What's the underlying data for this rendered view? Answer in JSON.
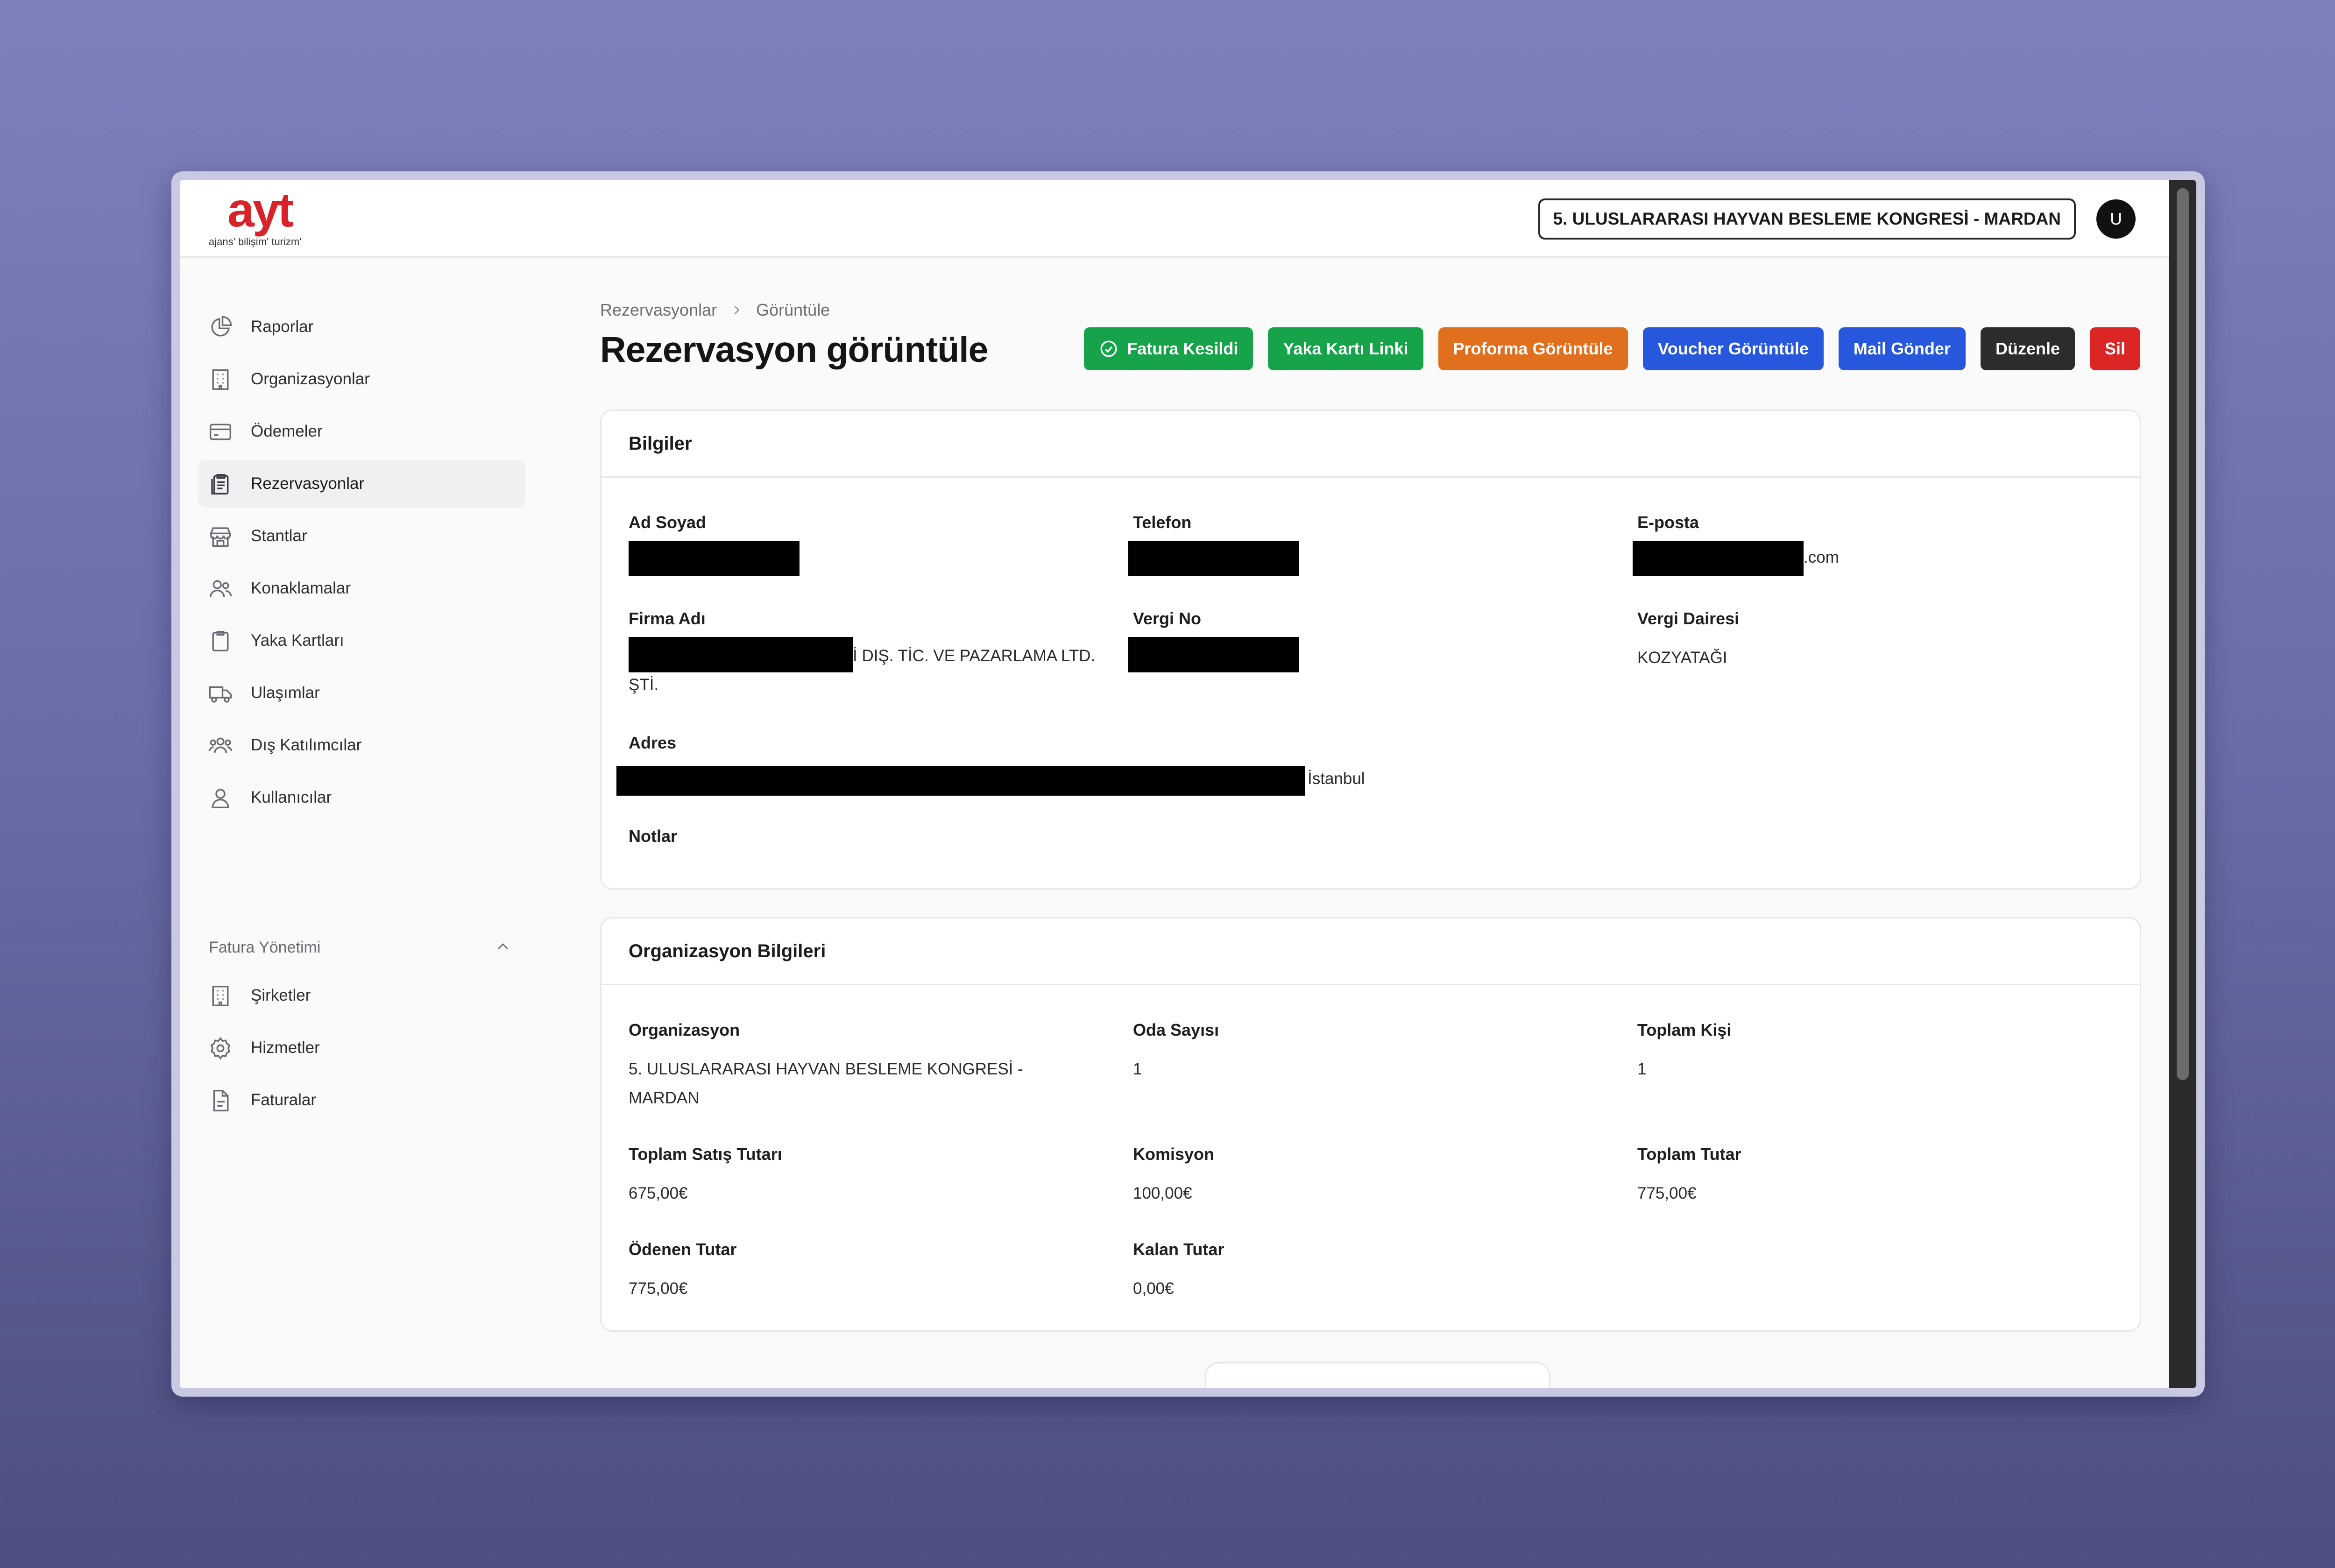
{
  "header": {
    "event_name": "5. ULUSLARARASI HAYVAN BESLEME KONGRESİ - MARDAN",
    "avatar_initial": "U",
    "logo_text": "ayt",
    "logo_sub": "ajans' bilişim' turizm'"
  },
  "sidebar": {
    "items": [
      {
        "label": "Raporlar",
        "icon": "chart-pie-icon"
      },
      {
        "label": "Organizasyonlar",
        "icon": "building-icon"
      },
      {
        "label": "Ödemeler",
        "icon": "credit-card-icon"
      },
      {
        "label": "Rezervasyonlar",
        "icon": "clipboard-icon",
        "active": true
      },
      {
        "label": "Stantlar",
        "icon": "storefront-icon"
      },
      {
        "label": "Konaklamalar",
        "icon": "users-icon"
      },
      {
        "label": "Yaka Kartları",
        "icon": "clipboard-blank-icon"
      },
      {
        "label": "Ulaşımlar",
        "icon": "truck-icon"
      },
      {
        "label": "Dış Katılımcılar",
        "icon": "user-group-icon"
      },
      {
        "label": "Kullanıcılar",
        "icon": "user-icon"
      }
    ],
    "group": {
      "label": "Fatura Yönetimi",
      "items": [
        {
          "label": "Şirketler",
          "icon": "building-icon"
        },
        {
          "label": "Hizmetler",
          "icon": "gear-icon"
        },
        {
          "label": "Faturalar",
          "icon": "document-icon"
        }
      ]
    }
  },
  "breadcrumb": {
    "parent": "Rezervasyonlar",
    "current": "Görüntüle"
  },
  "page_title": "Rezervasyon görüntüle",
  "actions": {
    "invoiced": "Fatura Kesildi",
    "badge_link": "Yaka Kartı Linki",
    "proforma": "Proforma Görüntüle",
    "voucher": "Voucher Görüntüle",
    "mail": "Mail Gönder",
    "edit": "Düzenle",
    "delete": "Sil"
  },
  "info_card": {
    "title": "Bilgiler",
    "name_label": "Ad Soyad",
    "phone_label": "Telefon",
    "email_label": "E-posta",
    "email_suffix": ".com",
    "company_label": "Firma Adı",
    "company_value": "İ DIŞ. TİC. VE PAZARLAMA LTD. ŞTİ.",
    "tax_no_label": "Vergi No",
    "tax_office_label": "Vergi Dairesi",
    "tax_office_value": "KOZYATAĞI",
    "address_label": "Adres",
    "address_suffix": "İstanbul",
    "notes_label": "Notlar"
  },
  "org_card": {
    "title": "Organizasyon Bilgileri",
    "org_label": "Organizasyon",
    "org_value": "5. ULUSLARARASI HAYVAN BESLEME KONGRESİ - MARDAN",
    "rooms_label": "Oda Sayısı",
    "rooms_value": "1",
    "people_label": "Toplam Kişi",
    "people_value": "1",
    "sales_label": "Toplam Satış Tutarı",
    "sales_value": "675,00€",
    "commission_label": "Komisyon",
    "commission_value": "100,00€",
    "total_label": "Toplam Tutar",
    "total_value": "775,00€",
    "paid_label": "Ödenen Tutar",
    "paid_value": "775,00€",
    "remaining_label": "Kalan Tutar",
    "remaining_value": "0,00€"
  }
}
